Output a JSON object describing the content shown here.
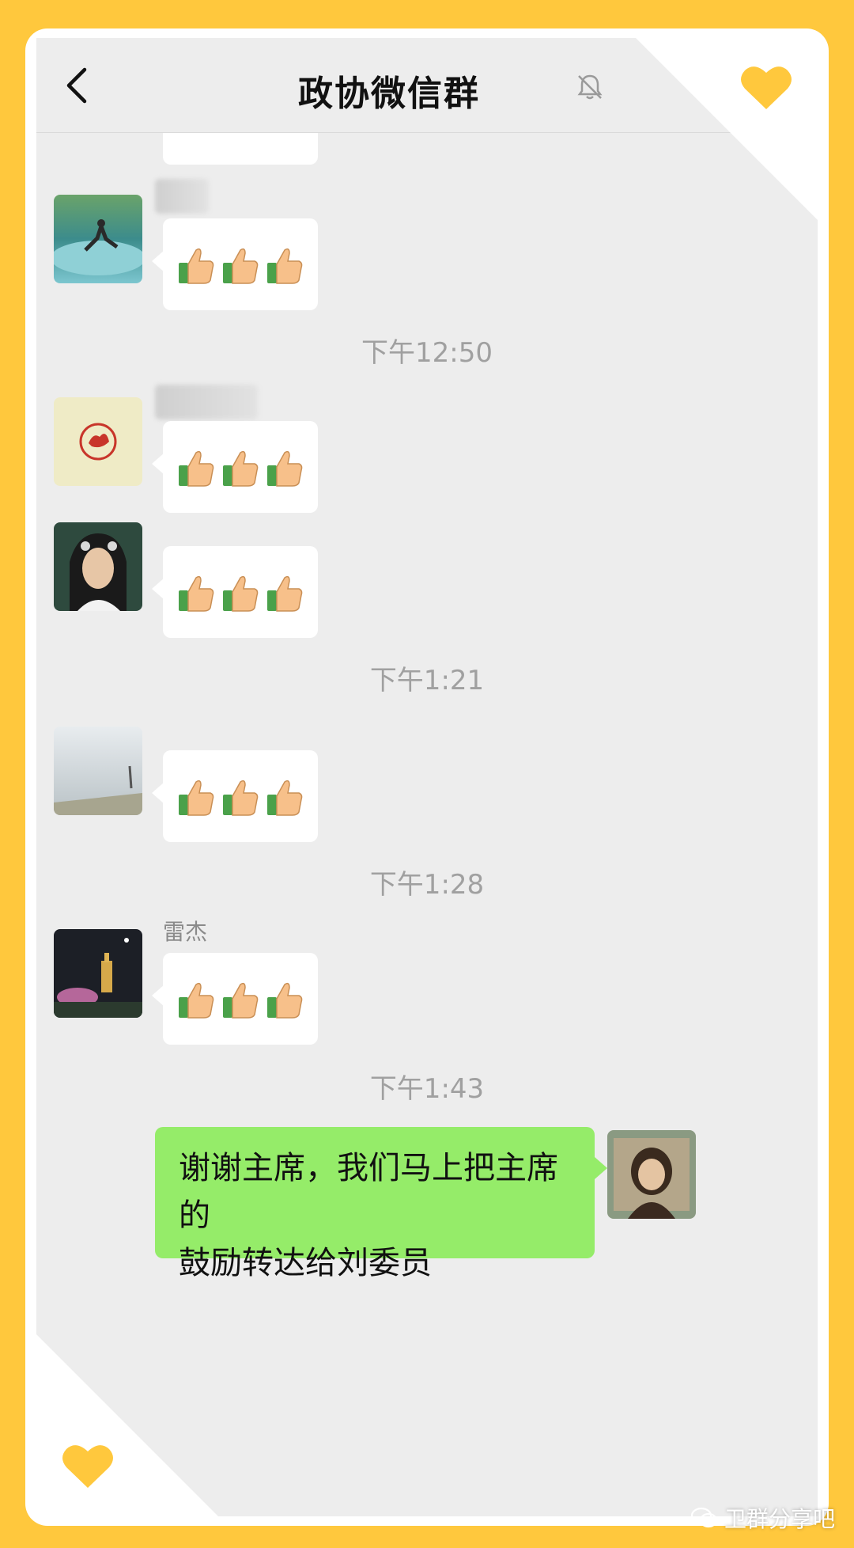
{
  "header": {
    "title": "政协微信群"
  },
  "messages": [
    {
      "sender": "",
      "content": "👍👍👍"
    },
    {
      "sender": "",
      "content": "👍👍👍"
    },
    {
      "sender": "",
      "content": "👍👍👍"
    },
    {
      "sender": "",
      "content": "👍👍👍"
    },
    {
      "sender": "雷杰",
      "content": "👍👍👍"
    }
  ],
  "timestamps": [
    "下午12:50",
    "下午1:21",
    "下午1:28",
    "下午1:43"
  ],
  "own_message": {
    "line1": "谢谢主席，我们马上把主席的",
    "line2": "鼓励转达给刘委员"
  },
  "watermark": "卫群分享吧",
  "colors": {
    "frame": "#FFC83D",
    "chat_bg": "#EDEDED",
    "own_bubble": "#95EC69",
    "heart": "#FFC83D"
  },
  "icons": [
    "back-arrow-icon",
    "mute-bell-icon",
    "heart-icon",
    "thumbs-up-icon",
    "wechat-logo-icon"
  ]
}
